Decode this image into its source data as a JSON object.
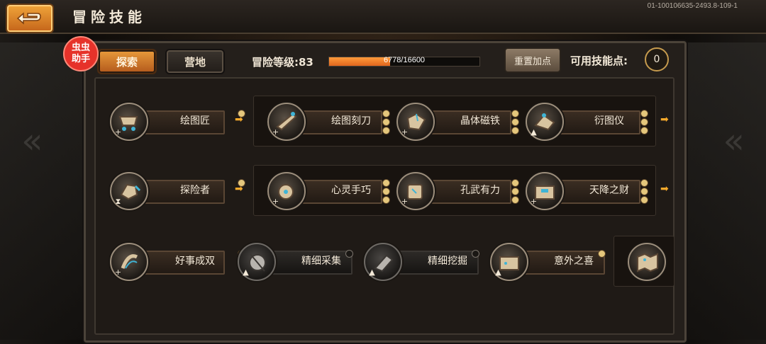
{
  "header": {
    "title": "冒险技能",
    "build_id": "01-100106635-2493.8-109-1"
  },
  "helper_badge": "虫虫\n助手",
  "tabs": [
    {
      "label": "探索",
      "active": true
    },
    {
      "label": "营地",
      "active": false
    }
  ],
  "level": {
    "label": "冒险等级:",
    "value": "83",
    "xp_text": "6778/16600",
    "xp_fraction": 0.408
  },
  "reset_button": "重置加点",
  "skill_points": {
    "label": "可用技能点:",
    "value": "0"
  },
  "skills": {
    "row1": [
      "绘图匠",
      "绘图刻刀",
      "晶体磁铁",
      "衍图仪"
    ],
    "row2": [
      "探险者",
      "心灵手巧",
      "孔武有力",
      "天降之财"
    ],
    "row3": [
      "好事成双",
      "精细采集",
      "精细挖掘",
      "意外之喜"
    ]
  },
  "colors": {
    "accent_orange": "#e99b3c",
    "xp_fill": "#ff9b3a",
    "badge_red": "#e6322a",
    "arrow": "#f4a92b"
  },
  "icons": [
    "back-arrow-icon",
    "cart-icon",
    "feather-icon",
    "gem-icon",
    "compass-icon",
    "hand-icon",
    "gear-icon",
    "fist-icon",
    "chest-icon",
    "dice-icon",
    "net-icon",
    "pick-icon",
    "gift-icon",
    "map-icon"
  ]
}
